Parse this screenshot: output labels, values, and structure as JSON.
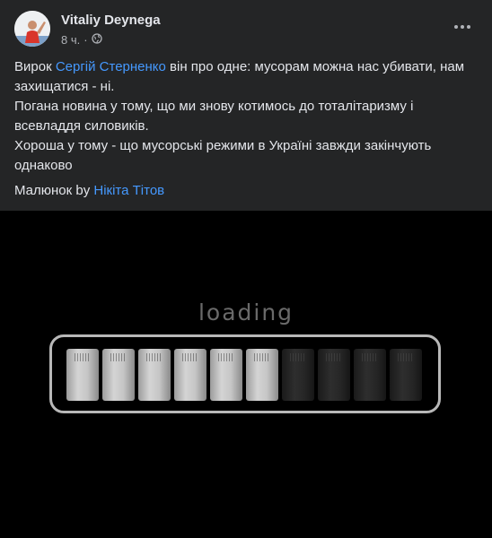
{
  "post": {
    "author": "Vitaliy Deynega",
    "time": "8 ч.",
    "separator": "·",
    "privacy_icon": "globe-icon",
    "more_icon": "more-dots-icon",
    "text": {
      "line1_prefix": "Вирок ",
      "line1_link": "Сергій Стерненко",
      "line1_suffix": " він про одне: мусорам можна нас убивати, нам захищатися - ні.",
      "line2": "Погана новина у тому, що ми знову котимось до тоталітаризму і всевладдя силовиків.",
      "line3": "Хороша у тому - що мусорські режими в Україні завжди закінчують однаково"
    },
    "credit_prefix": "Малюнок by ",
    "credit_link": "Нікіта Тітов"
  },
  "image": {
    "label": "loading",
    "progress": {
      "filled": 6,
      "total": 10
    }
  },
  "colors": {
    "background": "#242526",
    "link": "#4599ff",
    "text": "#e4e6eb",
    "muted": "#b0b3b8"
  }
}
